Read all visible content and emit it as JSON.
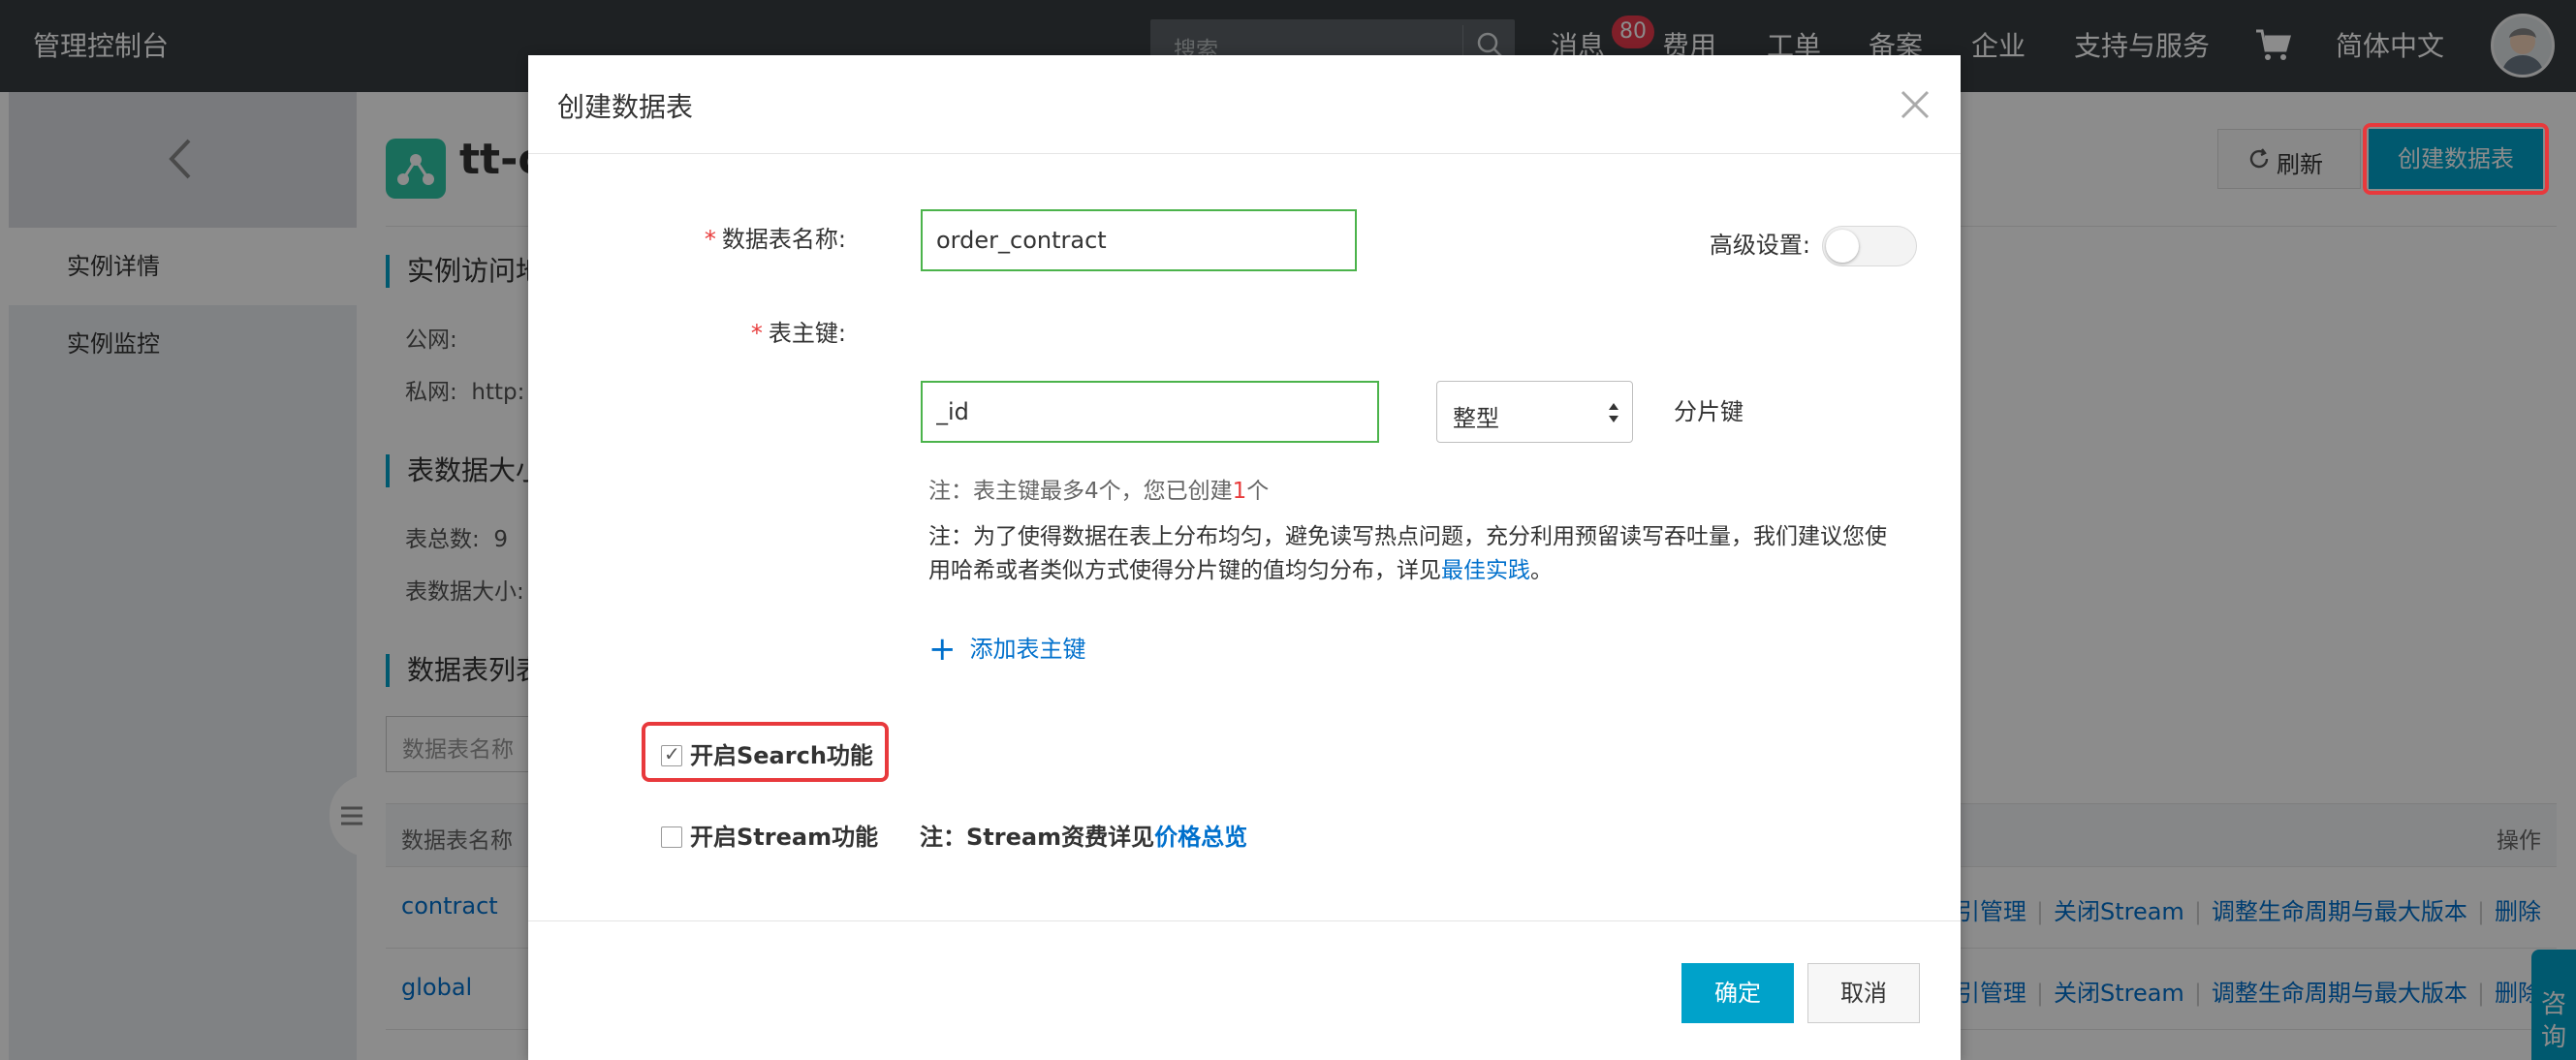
{
  "topbar": {
    "brand": "管理控制台",
    "search_placeholder": "搜索",
    "messages_label": "消息",
    "messages_badge": "80",
    "nav": [
      "费用",
      "工单",
      "备案",
      "企业",
      "支持与服务"
    ],
    "language": "简体中文"
  },
  "sidebar": {
    "items": [
      "实例详情",
      "实例监控"
    ]
  },
  "page": {
    "instance_title": "tt-c",
    "section_access": "实例访问地",
    "public_label": "公网:",
    "private_label": "私网:",
    "private_value": "http:",
    "section_size": "表数据大小",
    "table_count_label": "表总数:",
    "table_count": "9",
    "data_size_label": "表数据大小:",
    "section_list": "数据表列表",
    "filter_placeholder": "数据表名称",
    "col_name": "数据表名称",
    "col_ops": "操作",
    "rows": [
      {
        "name": "contract",
        "actions": [
          "索引管理",
          "关闭Stream",
          "调整生命周期与最大版本",
          "删除"
        ]
      },
      {
        "name": "global",
        "actions": [
          "索引管理",
          "关闭Stream",
          "调整生命周期与最大版本",
          "删除"
        ]
      }
    ],
    "refresh_label": "刷新",
    "create_label": "创建数据表",
    "consult_label": "咨询"
  },
  "modal": {
    "title": "创建数据表",
    "table_name_label": "数据表名称:",
    "table_name_value": "order_contract",
    "advanced_label": "高级设置:",
    "pk_label": "表主键:",
    "pk_value": "_id",
    "pk_type": "整型",
    "shard_key_label": "分片键",
    "note_pk_prefix": "注：表主键最多4个，您已创建",
    "note_pk_count": "1",
    "note_pk_suffix": "个",
    "note_distribution": "注：为了使得数据在表上分布均匀，避免读写热点问题，充分利用预留读写吞吐量，我们建议您使用哈希或者类似方式使得分片键的值均匀分布，详见",
    "note_best_practice": "最佳实践",
    "note_end": "。",
    "add_pk_label": "添加表主键",
    "search_feature_label": "开启Search功能",
    "stream_feature_label": "开启Stream功能",
    "stream_note_prefix": "注：Stream资费详见",
    "stream_note_link": "价格总览",
    "ok_label": "确定",
    "cancel_label": "取消"
  },
  "colors": {
    "topbar_bg": "#373d41",
    "primary": "#00a2ca",
    "link": "#0070cc",
    "highlight": "#e8393c",
    "valid_border": "#4bb34b"
  }
}
